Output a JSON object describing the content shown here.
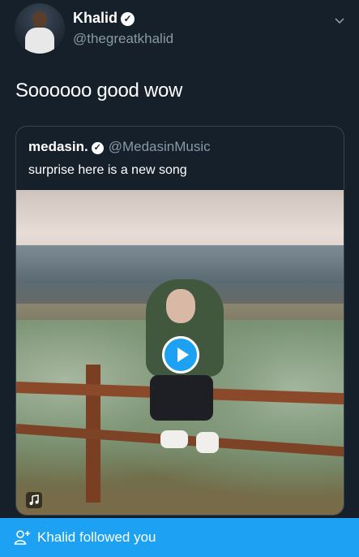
{
  "tweet": {
    "author_name": "Khalid",
    "author_handle": "@thegreatkhalid",
    "text": "Soooooo good wow"
  },
  "quote": {
    "author_name": "medasin.",
    "author_handle": "@MedasinMusic",
    "text": "surprise here is a new song"
  },
  "toast": {
    "text": "Khalid followed you"
  },
  "icons": {
    "verified": "verified-badge-icon",
    "chevron": "chevron-down-icon",
    "play": "play-icon",
    "music": "music-note-icon",
    "follow": "follow-user-icon"
  },
  "colors": {
    "background": "#15202b",
    "accent": "#1da1f2",
    "secondary_text": "#8899a6",
    "border": "#38444d"
  }
}
